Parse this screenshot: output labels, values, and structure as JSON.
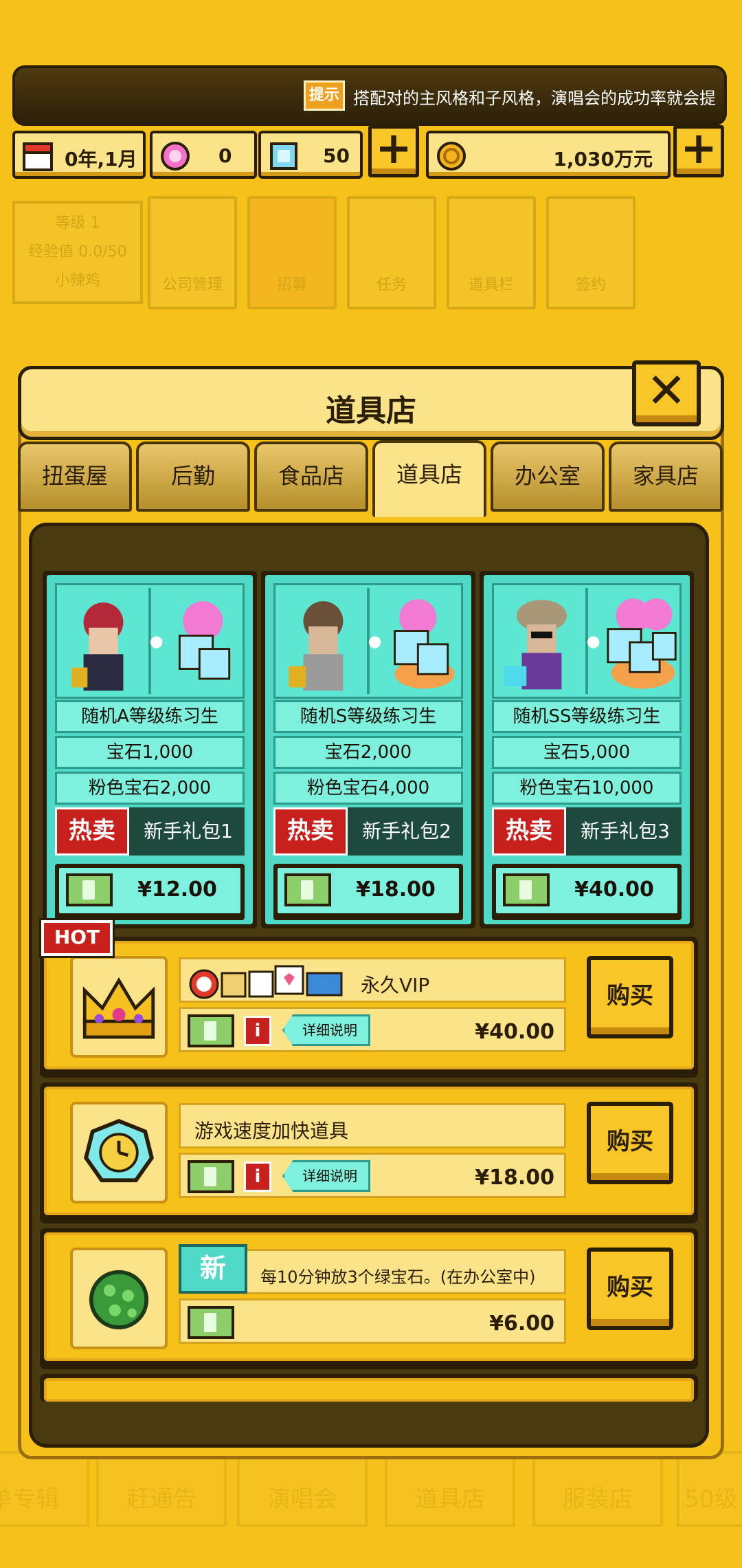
{
  "hint": {
    "badge": "提示",
    "text": "搭配对的主风格和子风格，演唱会的成功率就会提"
  },
  "currency": {
    "date": "0年,1月",
    "pink_gems": "0",
    "gems": "50",
    "money": "1,030万元"
  },
  "background": {
    "stats": [
      "等级 1",
      "经验值 0.0/50",
      "小辣鸡"
    ],
    "tiles": [
      "公司管理",
      "招募",
      "任务",
      "道具栏",
      "签约"
    ],
    "bottom_nav": [
      "单专辑",
      "赶通告",
      "演唱会",
      "道具店",
      "服装店",
      "50级"
    ]
  },
  "dialog": {
    "title": "道具店",
    "close": "✕"
  },
  "tabs": [
    {
      "label": "扭蛋屋",
      "active": false
    },
    {
      "label": "后勤",
      "active": false
    },
    {
      "label": "食品店",
      "active": false
    },
    {
      "label": "道具店",
      "active": true
    },
    {
      "label": "办公室",
      "active": false
    },
    {
      "label": "家具店",
      "active": false
    }
  ],
  "packs": [
    {
      "title": "随机A等级练习生",
      "gems": "宝石1,000",
      "pink": "粉色宝石2,000",
      "hot": "热卖",
      "bundle": "新手礼包1",
      "price": "¥12.00"
    },
    {
      "title": "随机S等级练习生",
      "gems": "宝石2,000",
      "pink": "粉色宝石4,000",
      "hot": "热卖",
      "bundle": "新手礼包2",
      "price": "¥18.00"
    },
    {
      "title": "随机SS等级练习生",
      "gems": "宝石5,000",
      "pink": "粉色宝石10,000",
      "hot": "热卖",
      "bundle": "新手礼包3",
      "price": "¥40.00"
    }
  ],
  "items": [
    {
      "name": "永久VIP",
      "price": "¥40.00",
      "detail": "详细说明",
      "info": "i",
      "buy": "购买",
      "hot": "HOT"
    },
    {
      "name": "游戏速度加快道具",
      "price": "¥18.00",
      "detail": "详细说明",
      "info": "i",
      "buy": "购买"
    },
    {
      "name": "每10分钟放3个绿宝石。(在办公室中)",
      "price": "¥6.00",
      "new": "新",
      "buy": "购买"
    }
  ],
  "colors": {
    "background": "#f6c21a",
    "teal": "#4fd9c6",
    "dark": "#2a1e06",
    "hot_red": "#c8201c"
  }
}
